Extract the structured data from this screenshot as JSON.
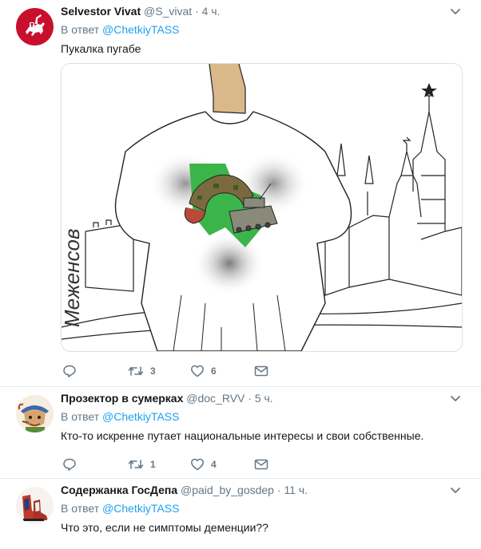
{
  "tweets": [
    {
      "name": "Selvestor Vivat",
      "handle": "@S_vivat",
      "separator": "·",
      "time": "4 ч.",
      "reply_prefix": "В ответ",
      "reply_to": "@ChetkiyTASS",
      "text": "Пукалка пугабе",
      "signature": "Меженсов",
      "retweets": "3",
      "likes": "6"
    },
    {
      "name": "Прозектор в сумерках",
      "handle": "@doc_RVV",
      "separator": "·",
      "time": "5 ч.",
      "reply_prefix": "В ответ",
      "reply_to": "@ChetkiyTASS",
      "text": "Кто-то искренне путает национальные интересы и свои собственные.",
      "retweets": "1",
      "likes": "4"
    },
    {
      "name": "Содержанка ГосДепа",
      "handle": "@paid_by_gosdep",
      "separator": "·",
      "time": "11 ч.",
      "reply_prefix": "В ответ",
      "reply_to": "@ChetkiyTASS",
      "text": "Что это, если не симптомы деменции??"
    }
  ],
  "colors": {
    "accent": "#1da1f2",
    "muted": "#657786",
    "text": "#14171a",
    "divider": "#e6ecf0"
  },
  "icons": [
    "reply-icon",
    "retweet-icon",
    "like-icon",
    "message-icon",
    "chevron-down-icon"
  ]
}
